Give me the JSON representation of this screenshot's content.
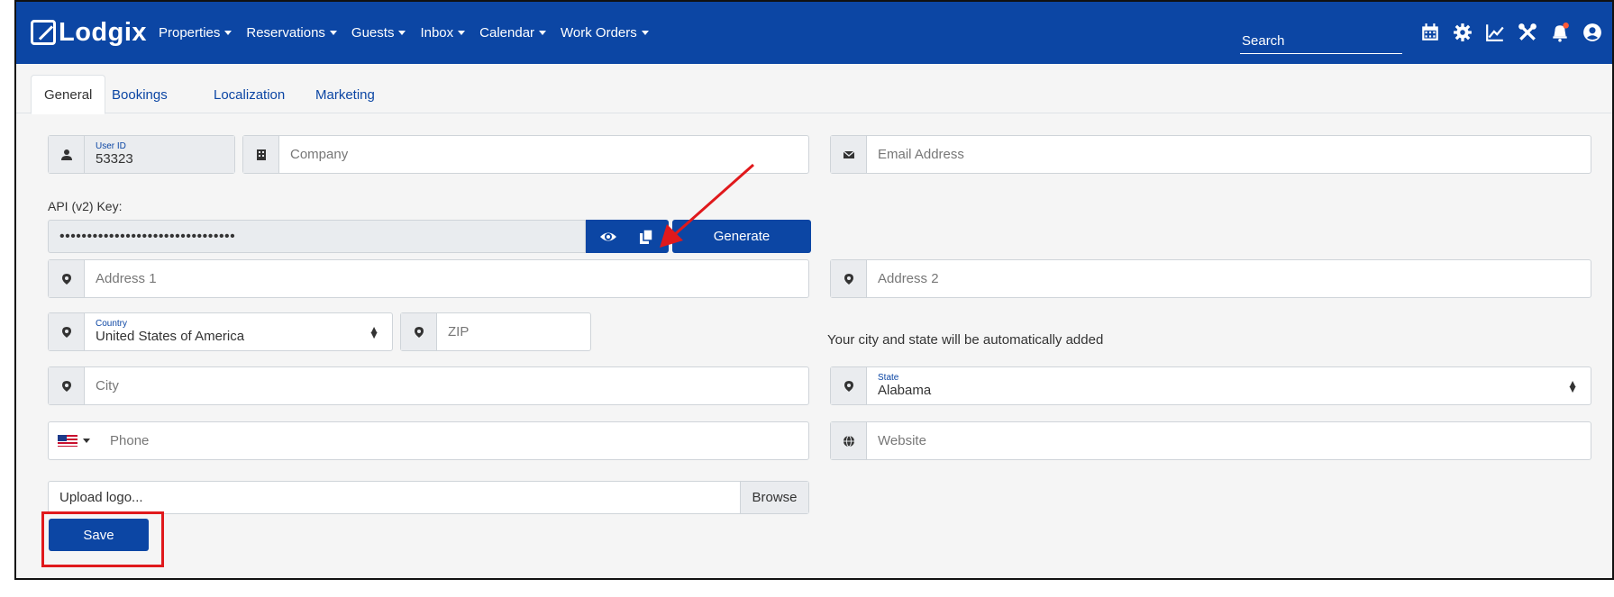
{
  "navbar": {
    "brand": "Lodgix",
    "menu": [
      {
        "label": "Properties"
      },
      {
        "label": "Reservations"
      },
      {
        "label": "Guests"
      },
      {
        "label": "Inbox"
      },
      {
        "label": "Calendar"
      },
      {
        "label": "Work Orders"
      }
    ],
    "search_placeholder": "Search",
    "icons": [
      "calendar-icon",
      "gear-icon",
      "chart-icon",
      "tools-icon",
      "bell-icon",
      "user-icon"
    ]
  },
  "tabs": [
    {
      "label": "General",
      "active": true
    },
    {
      "label": "Bookings",
      "active": false
    },
    {
      "label": "Localization",
      "active": false
    },
    {
      "label": "Marketing",
      "active": false
    }
  ],
  "form": {
    "user_id_label": "User ID",
    "user_id_value": "53323",
    "company_placeholder": "Company",
    "email_placeholder": "Email Address",
    "api_label": "API (v2) Key:",
    "api_value": "••••••••••••••••••••••••••••••••",
    "generate_label": "Generate",
    "address1_placeholder": "Address 1",
    "address2_placeholder": "Address 2",
    "country_label": "Country",
    "country_value": "United States of America",
    "zip_placeholder": "ZIP",
    "city_state_hint": "Your city and state will be automatically added",
    "city_placeholder": "City",
    "state_label": "State",
    "state_value": "Alabama",
    "phone_placeholder": "Phone",
    "website_placeholder": "Website",
    "upload_placeholder": "Upload logo...",
    "browse_label": "Browse",
    "save_label": "Save"
  },
  "colors": {
    "brand": "#0c46a4",
    "highlight": "#e0191c"
  }
}
